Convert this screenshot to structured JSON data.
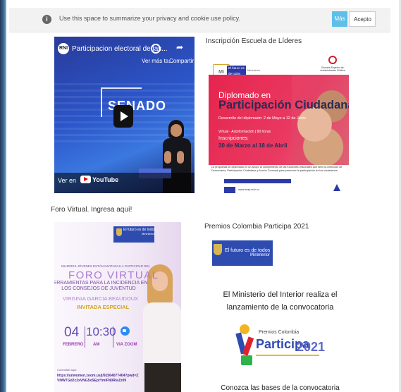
{
  "cookie_bar": {
    "info_icon": "info-icon",
    "text": "Use this space to summarize your privacy and cookie use policy.",
    "more_label": "Más",
    "accept_label": "Acepto",
    "accent_color": "#5cc0e8"
  },
  "video": {
    "channel_logo": "RNI",
    "title": "Participacion electoral de las...",
    "watch_later_label": "Ver más ta...",
    "share_label": "Compartir",
    "overlay_text": "SENADO",
    "watch_on_label": "Ver en",
    "platform_label": "YouTube",
    "icons": [
      "clock-icon",
      "share-icon",
      "play-icon",
      "youtube-icon"
    ]
  },
  "card_escuela": {
    "caption": "Inscripción Escuela de Líderes",
    "brand_text": "El futuro es de todos",
    "ministry": "Mininterior",
    "logo_text": "MI",
    "crest_text": "Escuela Superior de Administración Pública",
    "heading_small": "Diplomado en",
    "heading_big": "Participación Ciudadana",
    "description": "Desarrollo del diplomado: 2 de Mayo a 12 de Junio",
    "modality": "Virtual - Autoformación | 80 horas",
    "enrollment_label": "Inscripciones:",
    "enrollment_dates": "30 de Marzo al 18 de Abril",
    "footer_text": "La propuesta de diplomado es un apoyo al cumplimiento de las funciones misionales que tiene la Dirección de Democracia, Participación Ciudadana y Acción Comunal para promover la participación de los ciudadanos.",
    "website": "www.esap.edu.co",
    "accent_color": "#e6254d"
  },
  "card_foro": {
    "caption": "Foro Virtual. Ingresa aquí!",
    "brand_text": "El futuro es de todos",
    "ministry": "Mininterior",
    "invite_text": "MUJERES JÓVENES ESTÁN INVITADAS A PARTICIPAR DEL",
    "title": "FORO VIRTUAL",
    "subtitle": "HERRAMIENTAS PARA LA INCIDENCIA EN LOS CONSEJOS DE JUVENTUD",
    "speaker": "VIRGINIA GARCIA BEAUDOUX",
    "speaker_role": "INVITADA ESPECIAL",
    "day": "04",
    "month": "FEBRERO",
    "time": "10:30",
    "ampm": "AM",
    "platform": "VIA ZOOM",
    "connect_label": "Conectate aquí:",
    "url": "https://unwomen.zoom.us/j/91564077404?pwd=ZVNWTGd2c2xVNG5xSEptYmlFN0RleZz09",
    "accent_color": "#ac7ccf"
  },
  "card_premios": {
    "caption": "Premios Colombia Participa 2021",
    "brand_text": "El futuro es de todos",
    "ministry": "Mininterior",
    "announcement": "El Ministerio del Interior realiza el lanzamiento de la convocatoria",
    "logo_small": "Premios Colombia",
    "logo_big": "Participa",
    "logo_year": "2021",
    "footer_text": "Conozca las bases de la convocatoria",
    "accent_color": "#2e4bb0"
  }
}
